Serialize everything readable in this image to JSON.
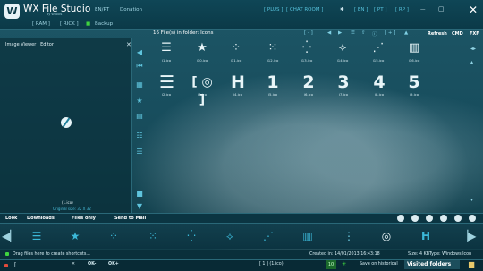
{
  "app": {
    "name": "WX File Studio",
    "subtitle": "by Wtools"
  },
  "top_menu": [
    "EN/PT",
    "Donation"
  ],
  "top_right": [
    "[ PLUS ]",
    "[ CHAT ROOM ]",
    "[ EN ]",
    "[ PT ]",
    "[ RP ]"
  ],
  "brackets": [
    "[ RAM ]",
    "[ RICK ]"
  ],
  "backup_label": "Backup",
  "viewer": {
    "title": "Image Viewer | Editor",
    "file_name": "(1.ico)",
    "original_size": "Original size: 32 X 32"
  },
  "folder_info": "16 File(s) in folder: Icons",
  "header_controls": [
    "[ - ]",
    "[ + ]"
  ],
  "header_links": [
    "Refresh",
    "CMD",
    "FXF"
  ],
  "icons_row1": [
    {
      "label": "i1.ico",
      "icon": "menu-lines-icon",
      "glyph": "☰"
    },
    {
      "label": "i10.ico",
      "icon": "star-icon",
      "glyph": "★"
    },
    {
      "label": "i11.ico",
      "icon": "dots-diagonal-icon",
      "glyph": "⁘"
    },
    {
      "label": "i12.ico",
      "icon": "dots-scatter-icon",
      "glyph": "⁙"
    },
    {
      "label": "i13.ico",
      "icon": "dots-grid-icon",
      "glyph": "⁛"
    },
    {
      "label": "i14.ico",
      "icon": "dot-arrows-icon",
      "glyph": "⟡"
    },
    {
      "label": "i15.ico",
      "icon": "diagonal-dots-icon",
      "glyph": "⋰"
    },
    {
      "label": "i16.ico",
      "icon": "bars-icon",
      "glyph": "▥"
    }
  ],
  "icons_row2": [
    {
      "label": "i2.ico",
      "icon": "menu-lines-icon",
      "glyph": "☰"
    },
    {
      "label": "i3.ico",
      "icon": "selected-circle-icon",
      "glyph": "◎"
    },
    {
      "label": "i4.ico",
      "icon": "h-letter-icon",
      "glyph": "H"
    },
    {
      "label": "i5.ico",
      "icon": "number-1-icon",
      "glyph": "1"
    },
    {
      "label": "i6.ico",
      "icon": "number-2-icon",
      "glyph": "2"
    },
    {
      "label": "i7.ico",
      "icon": "number-3-icon",
      "glyph": "3"
    },
    {
      "label": "i8.ico",
      "icon": "number-4-icon",
      "glyph": "4"
    },
    {
      "label": "i9.ico",
      "icon": "number-5-icon",
      "glyph": "5"
    }
  ],
  "tabs": [
    "Look",
    "Downloads",
    "Files only",
    "Send to Mail"
  ],
  "shortcuts": [
    "☰",
    "★",
    "⁘",
    "⁙",
    "⁛",
    "⟡",
    "⋰",
    "▥",
    "◎",
    "H"
  ],
  "status": {
    "hint": "Drag files here to create shortcuts...",
    "created": "Created in: 14/01/2013 16:43:18",
    "size": "Size: 4 KB",
    "type": "Type: Windows Icon"
  },
  "bottom": {
    "ok1": "OK-",
    "ok2": "OK+",
    "current": "[ 1 ] (1.ico)",
    "page": "10",
    "save": "Save on historical",
    "visited": "Visited folders"
  }
}
